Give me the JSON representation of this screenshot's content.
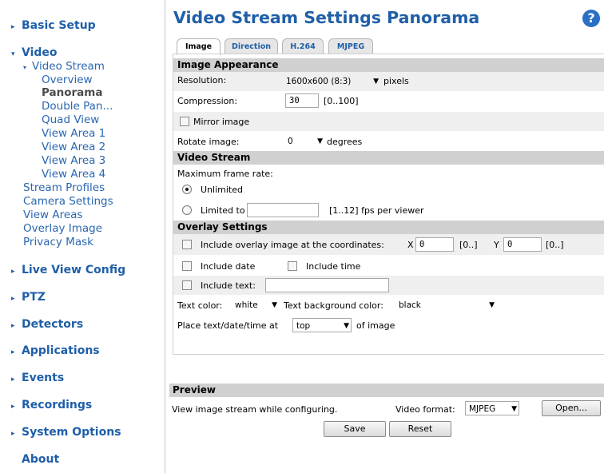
{
  "sidebar": {
    "basic_setup": "Basic Setup",
    "video": "Video",
    "video_stream": "Video Stream",
    "overview": "Overview",
    "panorama": "Panorama",
    "double_pan": "Double Pan...",
    "quad_view": "Quad View",
    "view_area_1": "View Area 1",
    "view_area_2": "View Area 2",
    "view_area_3": "View Area 3",
    "view_area_4": "View Area 4",
    "stream_profiles": "Stream Profiles",
    "camera_settings": "Camera Settings",
    "view_areas": "View Areas",
    "overlay_image": "Overlay Image",
    "privacy_mask": "Privacy Mask",
    "live_view_config": "Live View Config",
    "ptz": "PTZ",
    "detectors": "Detectors",
    "applications": "Applications",
    "events": "Events",
    "recordings": "Recordings",
    "system_options": "System Options",
    "about": "About"
  },
  "page": {
    "title": "Video Stream Settings Panorama",
    "help": "?"
  },
  "tabs": [
    "Image",
    "Direction",
    "H.264",
    "MJPEG"
  ],
  "image_appearance": {
    "header": "Image Appearance",
    "resolution_label": "Resolution:",
    "resolution_value": "1600x600 (8:3)",
    "resolution_unit": "pixels",
    "compression_label": "Compression:",
    "compression_value": "30",
    "compression_range": "[0..100]",
    "mirror_label": "Mirror image",
    "mirror_checked": false,
    "rotate_label": "Rotate image:",
    "rotate_value": "0",
    "rotate_unit": "degrees"
  },
  "video_stream": {
    "header": "Video Stream",
    "max_frame_rate_label": "Maximum frame rate:",
    "unlimited_label": "Unlimited",
    "unlimited_selected": true,
    "limited_label": "Limited to",
    "limited_value": "",
    "limited_range": "[1..12] fps per viewer"
  },
  "overlay": {
    "header": "Overlay Settings",
    "include_image_label": "Include overlay image at the coordinates:",
    "x_label": "X",
    "x_value": "0",
    "x_range": "[0..]",
    "y_label": "Y",
    "y_value": "0",
    "y_range": "[0..]",
    "include_date_label": "Include date",
    "include_time_label": "Include time",
    "include_text_label": "Include text:",
    "text_value": "",
    "text_color_label": "Text color:",
    "text_color_value": "white",
    "bg_color_label": "Text background color:",
    "bg_color_value": "black",
    "place_label": "Place text/date/time at",
    "place_value": "top",
    "place_suffix": "of image"
  },
  "preview": {
    "header": "Preview",
    "description": "View image stream while configuring.",
    "format_label": "Video format:",
    "format_value": "MJPEG",
    "open_label": "Open..."
  },
  "actions": {
    "save": "Save",
    "reset": "Reset"
  },
  "colors": {
    "link_blue": "#1f5fa8",
    "header_gray": "#d0d0d0"
  }
}
